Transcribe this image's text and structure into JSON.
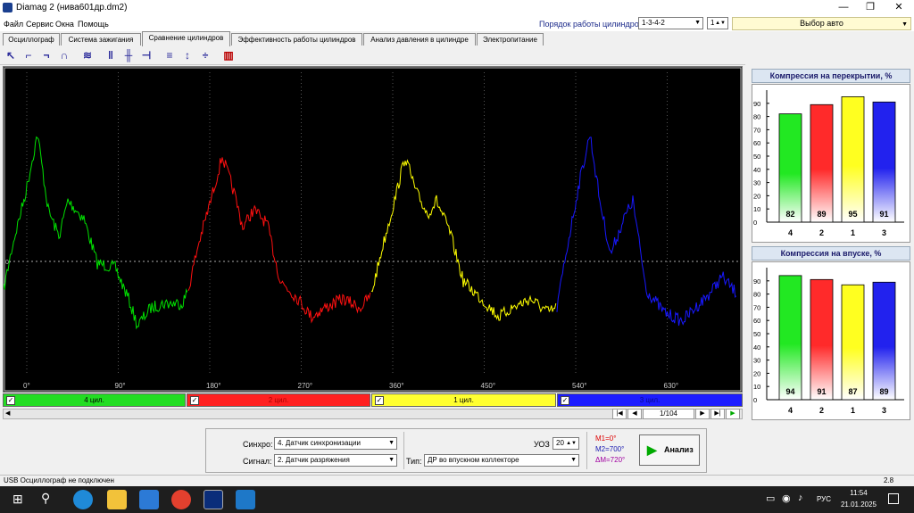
{
  "window": {
    "title": "Diamag 2 (нива601др.dm2)",
    "minimize": "—",
    "maximize": "❐",
    "close": "✕"
  },
  "menu": [
    "Файл",
    "Сервис",
    "Окна",
    "Помощь"
  ],
  "cyl_order": {
    "label": "Порядок работы цилиндров",
    "value": "1-3-4-2",
    "spin_value": "1"
  },
  "auto_select": "Выбор авто",
  "tabs": [
    {
      "label": "Осциллограф",
      "color": "#c9e7c2"
    },
    {
      "label": "Система зажигания",
      "color": "#e2b7d8"
    },
    {
      "label": "Сравнение цилиндров",
      "color": "#ffffff"
    },
    {
      "label": "Эффективность работы цилиндров",
      "color": "#c8c8e6"
    },
    {
      "label": "Анализ давления в цилиндре",
      "color": "#c7e8c2"
    },
    {
      "label": "Электропитание",
      "color": "#e9cfc0"
    }
  ],
  "toolbar_icons": [
    "cursor-icon",
    "signal-rise-icon",
    "signal-fall-icon",
    "signal-pulse-icon",
    "compress-icon",
    "cursors-icon",
    "marker-icon",
    "edit-icon",
    "grid-icon",
    "scale-icon",
    "split-icon",
    "report-icon"
  ],
  "scope": {
    "x_ticks": [
      "0°",
      "90°",
      "180°",
      "270°",
      "360°",
      "450°",
      "540°",
      "630°"
    ],
    "zero_label": "0-",
    "colors": {
      "cyl4": "#00e000",
      "cyl2": "#ff1010",
      "cyl1": "#ffff00",
      "cyl3": "#1818ff"
    }
  },
  "cyl_bars": [
    {
      "label": "4 цил.",
      "color": "#22dd22",
      "check": "✓"
    },
    {
      "label": "2 цил.",
      "color": "#ff2020",
      "check": "✓"
    },
    {
      "label": "1 цил.",
      "color": "#ffff30",
      "check": "✓"
    },
    {
      "label": "3 цил.",
      "color": "#1c1cff",
      "check": "✓"
    }
  ],
  "nav": {
    "page": "1/104",
    "first": "|◀",
    "prev": "◀",
    "next": "▶",
    "last": "▶|",
    "play": "▶"
  },
  "compression_overlap": {
    "title": "Компрессия на перекрытии, %",
    "y_ticks": [
      "90",
      "80",
      "70",
      "60",
      "50",
      "40",
      "30",
      "20",
      "10",
      "0"
    ],
    "bars": [
      {
        "cyl": "4",
        "value": 82,
        "color": "#22e822"
      },
      {
        "cyl": "2",
        "value": 89,
        "color": "#ff2a2a"
      },
      {
        "cyl": "1",
        "value": 95,
        "color": "#ffff20"
      },
      {
        "cyl": "3",
        "value": 91,
        "color": "#2222ee"
      }
    ]
  },
  "compression_intake": {
    "title": "Компрессия на впуске, %",
    "y_ticks": [
      "90",
      "80",
      "70",
      "60",
      "50",
      "40",
      "30",
      "20",
      "10",
      "0"
    ],
    "bars": [
      {
        "cyl": "4",
        "value": 94,
        "color": "#22e822"
      },
      {
        "cyl": "2",
        "value": 91,
        "color": "#ff2a2a"
      },
      {
        "cyl": "1",
        "value": 87,
        "color": "#ffff20"
      },
      {
        "cyl": "3",
        "value": 89,
        "color": "#2222ee"
      }
    ]
  },
  "settings": {
    "sync_label": "Синхро:",
    "sync_value": "4. Датчик синхронизации",
    "signal_label": "Сигнал:",
    "signal_value": "2. Датчик разряжения",
    "uoz_label": "УОЗ",
    "uoz_value": "20",
    "type_label": "Тип:",
    "type_value": "ДР во впускном коллекторе",
    "m1": "M1=0°",
    "m2": "M2=700°",
    "dm": "ΔM=720°",
    "analyze": "Анализ"
  },
  "status": {
    "left": "USB Осциллограф не подключен",
    "right": "2.8"
  },
  "taskbar": {
    "lang": "РУС",
    "time": "11:54",
    "date": "21.01.2025"
  }
}
